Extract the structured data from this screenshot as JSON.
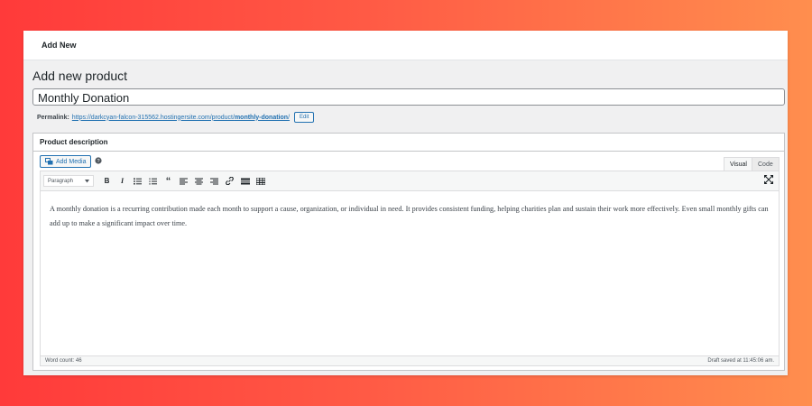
{
  "topbar": {
    "add_new": "Add New"
  },
  "page": {
    "title": "Add new product"
  },
  "product": {
    "title_value": "Monthly Donation"
  },
  "permalink": {
    "label": "Permalink:",
    "base_url": "https://darkcyan-falcon-315562.hostingersite.com/product/",
    "slug": "monthly-donation",
    "trailing": "/",
    "edit_label": "Edit"
  },
  "description": {
    "header": "Product description",
    "add_media_label": "Add Media",
    "help": "?",
    "tabs": {
      "visual": "Visual",
      "code": "Code"
    },
    "format_select": "Paragraph",
    "content": "A monthly donation is a recurring contribution made each month to support a cause, organization, or individual in need. It provides consistent funding, helping charities plan and sustain their work more effectively. Even small monthly gifts can add up to make a significant impact over time.",
    "word_count": "Word count: 46",
    "draft_saved": "Draft saved at 11:45:06 am."
  },
  "toolbar": {
    "bold": "B",
    "italic": "I",
    "blockquote": "“"
  },
  "colors": {
    "accent": "#2271b1",
    "background_left": "#ff3a3a",
    "background_right": "#ff8e4e"
  }
}
